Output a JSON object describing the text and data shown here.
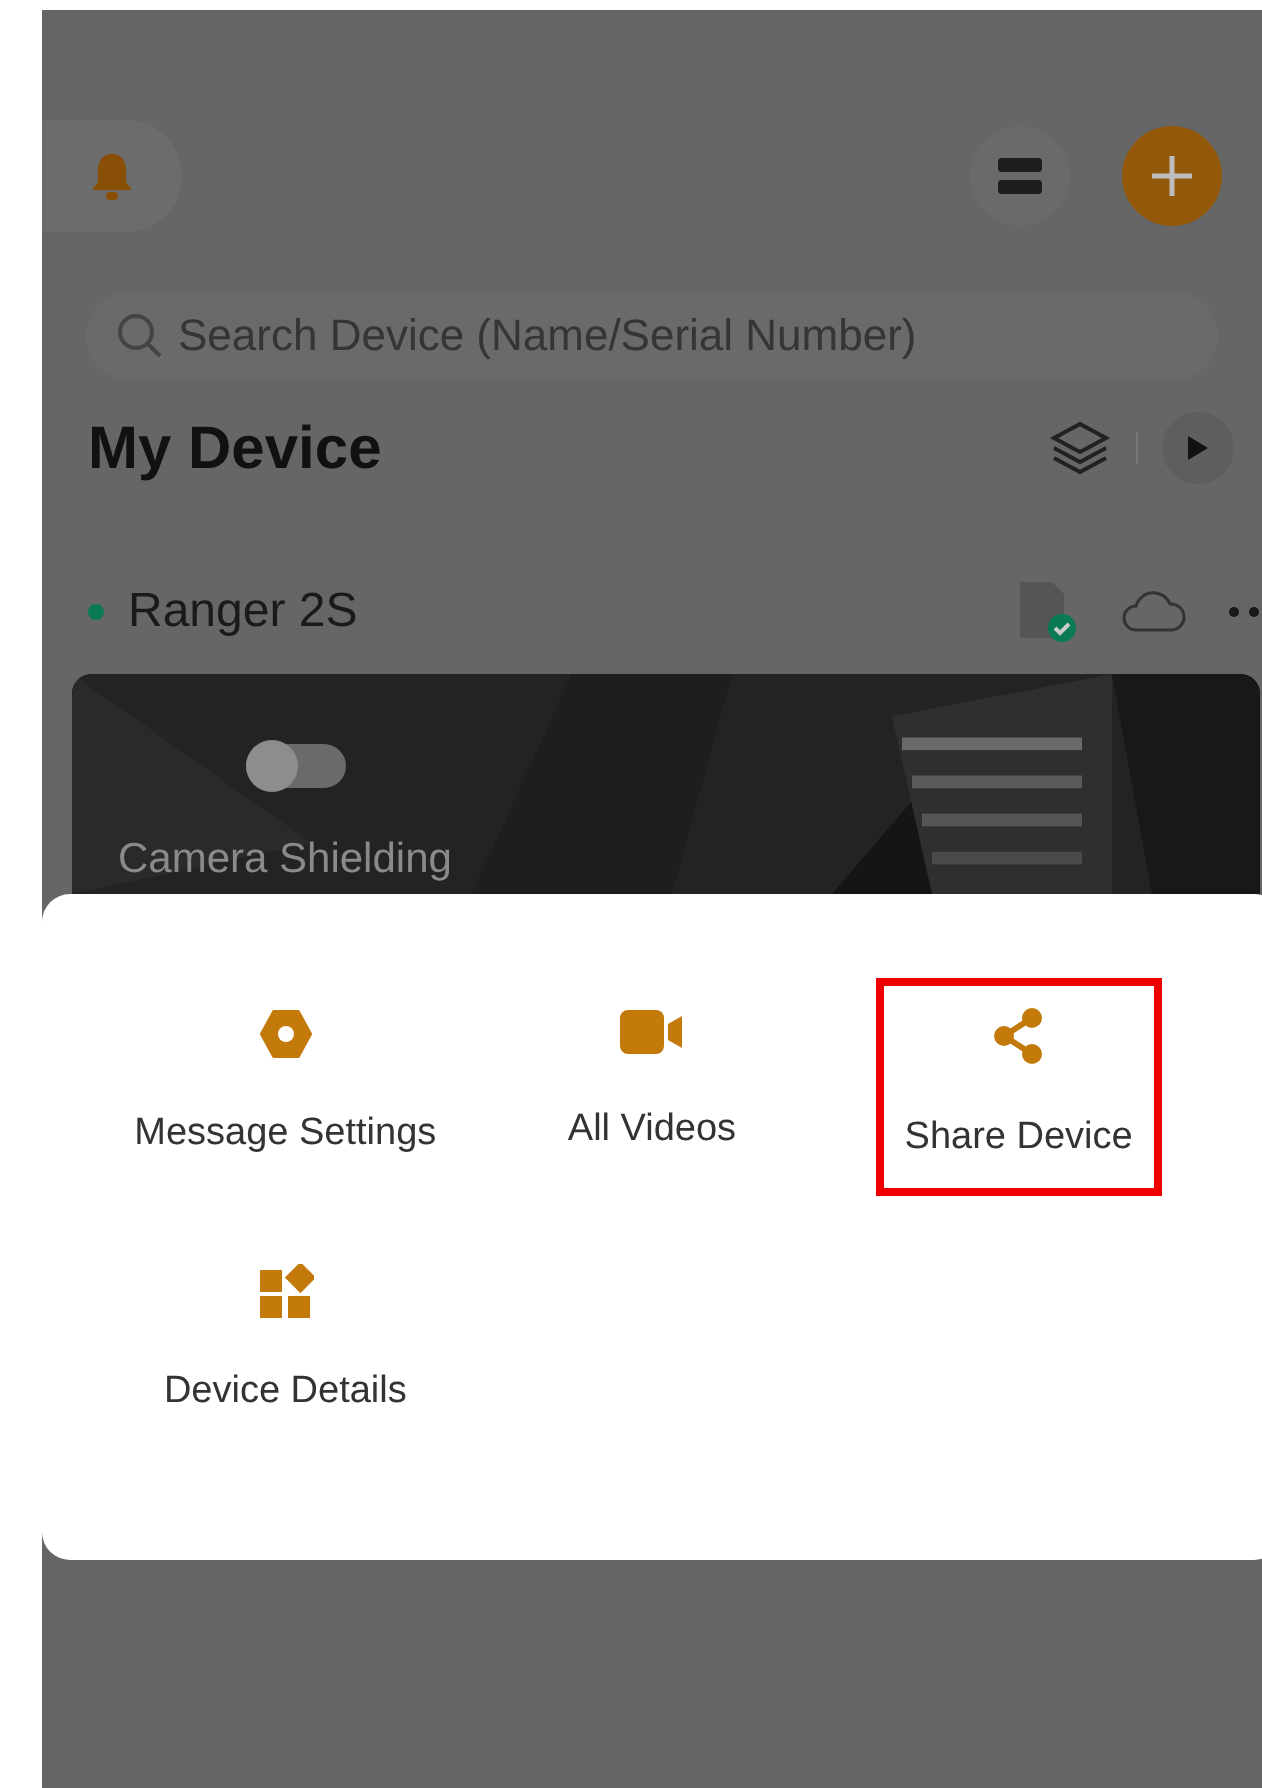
{
  "search": {
    "placeholder": "Search Device (Name/Serial Number)"
  },
  "section_title": "My Device",
  "device": {
    "name": "Ranger 2S",
    "online": true,
    "camera_shielding": {
      "label": "Camera Shielding",
      "on": false
    }
  },
  "menu": [
    {
      "kind": "settings",
      "label": "Message Settings",
      "highlighted": false
    },
    {
      "kind": "videos",
      "label": "All Videos",
      "highlighted": false
    },
    {
      "kind": "share",
      "label": "Share Device",
      "highlighted": true
    },
    {
      "kind": "details",
      "label": "Device Details",
      "highlighted": false
    }
  ]
}
